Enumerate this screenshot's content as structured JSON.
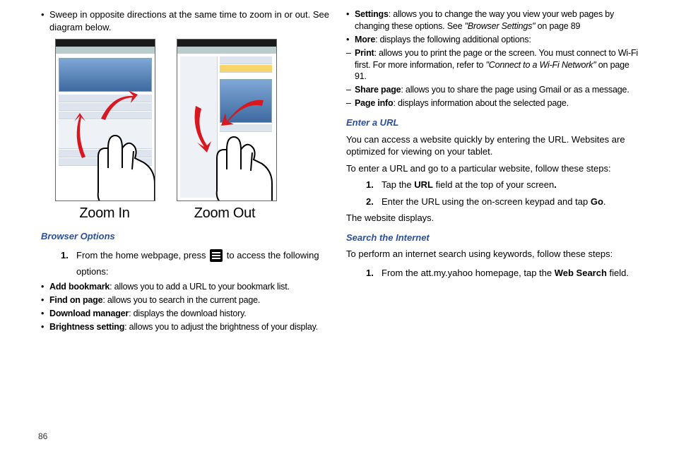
{
  "left": {
    "sweep_bullet": "Sweep in opposite directions at the same time to zoom in or out. See diagram below.",
    "fig_zoom_in": "Zoom In",
    "fig_zoom_out": "Zoom Out",
    "heading_browser_options": "Browser Options",
    "step1_a": "From the home webpage, press ",
    "step1_b": " to access the following options:",
    "opts": {
      "add_bm_label": "Add bookmark",
      "add_bm_text": ": allows you to add a URL to your bookmark list.",
      "find_label": "Find on page",
      "find_text": ": allows you to search in the current page.",
      "dl_label": "Download manager",
      "dl_text": ": displays the download history.",
      "bright_label": "Brightness setting",
      "bright_text": ": allows you to adjust the brightness of your display."
    }
  },
  "right": {
    "opts": {
      "settings_label": "Settings",
      "settings_text_a": ": allows you to change the way you view your web pages by changing these options. See ",
      "settings_ref": "\"Browser Settings\"",
      "settings_text_b": " on page 89",
      "more_label": "More",
      "more_text": ": displays the following additional options:",
      "print_label": "Print",
      "print_text_a": ": allows you to print the page or the screen. You must connect to Wi-Fi first. For more information, refer to ",
      "print_ref": "\"Connect to a Wi-Fi Network\"",
      "print_text_b": "  on page 91.",
      "share_label": "Share page",
      "share_text": ": allows you to share the page using Gmail or as a message.",
      "pageinfo_label": "Page info",
      "pageinfo_text": ": displays information about the selected page."
    },
    "heading_enter_url": "Enter a URL",
    "enter_url_p1": "You can access a website quickly by entering the URL. Websites are optimized for viewing on your tablet.",
    "enter_url_p2": "To enter a URL and go to a particular website, follow these steps:",
    "url_step1_a": "Tap the ",
    "url_step1_b": "URL",
    "url_step1_c": " field at the top of your screen",
    "url_step2_a": "Enter the URL using the on-screen keypad and tap ",
    "url_step2_b": "Go",
    "url_step2_c": ".",
    "url_result": "The website displays.",
    "heading_search": "Search the Internet",
    "search_p1": "To perform an internet search using keywords, follow these steps:",
    "search_step1_a": "From the att.my.yahoo homepage, tap the ",
    "search_step1_b": "Web Search",
    "search_step1_c": " field."
  },
  "page_number": "86",
  "icons": {
    "menu": "menu-icon"
  }
}
